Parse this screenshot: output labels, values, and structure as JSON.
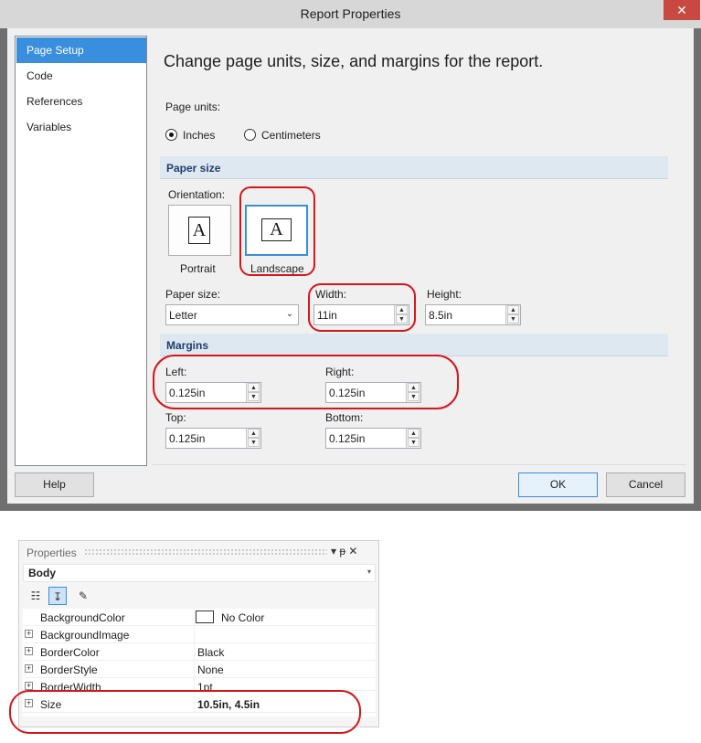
{
  "dialog": {
    "title": "Report Properties",
    "close_glyph": "✕",
    "nav_items": [
      {
        "label": "Page Setup",
        "selected": true
      },
      {
        "label": "Code",
        "selected": false
      },
      {
        "label": "References",
        "selected": false
      },
      {
        "label": "Variables",
        "selected": false
      }
    ],
    "heading": "Change page units, size, and margins for the report.",
    "page_units": {
      "label": "Page units:",
      "options": [
        {
          "label": "Inches",
          "selected": true
        },
        {
          "label": "Centimeters",
          "selected": false
        }
      ]
    },
    "paper_section": {
      "title": "Paper size",
      "orientation_label": "Orientation:",
      "orientations": [
        {
          "label": "Portrait",
          "glyph": "A",
          "selected": false
        },
        {
          "label": "Landscape",
          "glyph": "A",
          "selected": true
        }
      ],
      "paper_size_label": "Paper size:",
      "paper_size_value": "Letter",
      "width_label": "Width:",
      "width_value": "11in",
      "height_label": "Height:",
      "height_value": "8.5in"
    },
    "margins_section": {
      "title": "Margins",
      "left_label": "Left:",
      "left_value": "0.125in",
      "right_label": "Right:",
      "right_value": "0.125in",
      "top_label": "Top:",
      "top_value": "0.125in",
      "bottom_label": "Bottom:",
      "bottom_value": "0.125in"
    },
    "buttons": {
      "help": "Help",
      "ok": "OK",
      "cancel": "Cancel"
    },
    "spinner_up": "▲",
    "spinner_down": "▼",
    "select_arrow": "⌄"
  },
  "properties": {
    "title": "Properties",
    "title_tools": "▾ ᵽ ✕",
    "object": "Body",
    "object_arrow": "▾",
    "toolbar": [
      {
        "name": "categorized",
        "glyph": "☷"
      },
      {
        "name": "alphabetical",
        "glyph": "↧"
      },
      {
        "name": "property-pages",
        "glyph": "✎"
      }
    ],
    "rows": [
      {
        "name": "BackgroundColor",
        "value": "No Color",
        "expandable": false,
        "swatch": true
      },
      {
        "name": "BackgroundImage",
        "value": "",
        "expandable": true
      },
      {
        "name": "BorderColor",
        "value": "Black",
        "expandable": true
      },
      {
        "name": "BorderStyle",
        "value": "None",
        "expandable": true
      },
      {
        "name": "BorderWidth",
        "value": "1pt",
        "expandable": true
      },
      {
        "name": "Size",
        "value": "10.5in, 4.5in",
        "expandable": true,
        "bold": true
      }
    ],
    "expand_glyph": "+"
  },
  "colors": {
    "accent": "#3a8ede",
    "annotation": "#d4161c",
    "close_button": "#c7493f",
    "section_header": "#dde8f0"
  }
}
